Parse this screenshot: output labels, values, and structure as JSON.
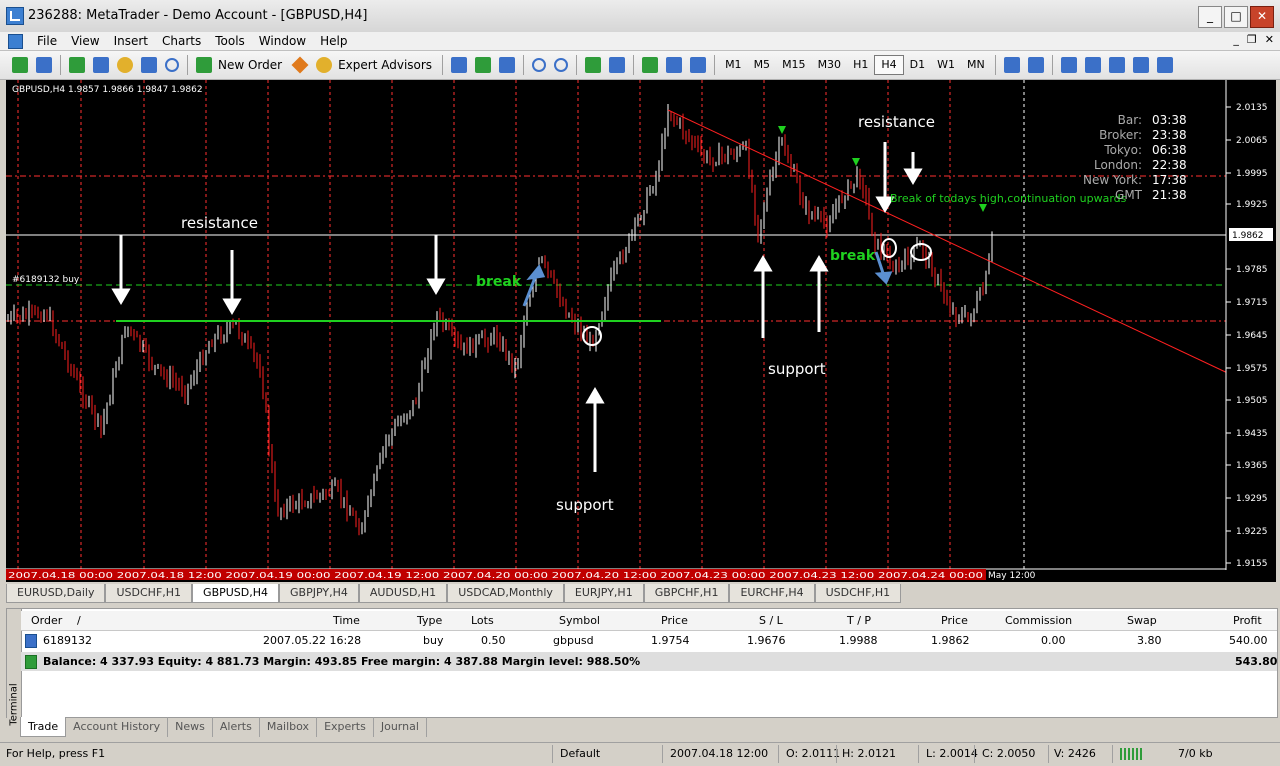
{
  "window": {
    "title": "236288: MetaTrader - Demo Account - [GBPUSD,H4]"
  },
  "menu": {
    "items": [
      "File",
      "View",
      "Insert",
      "Charts",
      "Tools",
      "Window",
      "Help"
    ]
  },
  "toolbar": {
    "new_order": "New Order",
    "expert_advisors": "Expert Advisors",
    "timeframes": [
      "M1",
      "M5",
      "M15",
      "M30",
      "H1",
      "H4",
      "D1",
      "W1",
      "MN"
    ],
    "active_timeframe": "H4"
  },
  "chart": {
    "header": "GBPUSD,H4  1.9857 1.9866 1.9847 1.9862",
    "price_labels": [
      "2.0135",
      "2.0065",
      "1.9995",
      "1.9925",
      "1.9785",
      "1.9715",
      "1.9645",
      "1.9575",
      "1.9505",
      "1.9435",
      "1.9365",
      "1.9295",
      "1.9225",
      "1.9155"
    ],
    "current_price": "1.9862",
    "order_line_label": "#6189132 buy",
    "time_axis_text": "2007.04.18 00:00  2007.04.18 12:00  2007.04.19 00:00  2007.04.19 12:00  2007.04.20 00:00  2007.04.20 12:00  2007.04.23 00:00  2007.04.23 12:00  2007.04.24 00:00",
    "time_axis_end": "May 12:00",
    "annotations": {
      "resistance_left": "resistance",
      "resistance_right": "resistance",
      "break_left": "break",
      "break_right": "break",
      "support_bottom": "support",
      "support_right": "support",
      "break_note": "Break of todays high,continuation upwards"
    },
    "clock": [
      {
        "label": "Bar:",
        "value": "03:38"
      },
      {
        "label": "Broker:",
        "value": "23:38"
      },
      {
        "label": "Tokyo:",
        "value": "06:38"
      },
      {
        "label": "London:",
        "value": "22:38"
      },
      {
        "label": "New York:",
        "value": "17:38"
      },
      {
        "label": "GMT",
        "value": "21:38"
      }
    ],
    "colors": {
      "bull": "#ffffff",
      "bear": "#ff2020",
      "support_line": "#1fd11f",
      "trend_line": "#ff2020",
      "level_red": "#ff3030",
      "level_green": "#1fd11f",
      "text_green": "#1fd11f"
    }
  },
  "symbol_tabs": [
    "EURUSD,Daily",
    "USDCHF,H1",
    "GBPUSD,H4",
    "GBPJPY,H4",
    "AUDUSD,H1",
    "USDCAD,Monthly",
    "EURJPY,H1",
    "GBPCHF,H1",
    "EURCHF,H4",
    "USDCHF,H1"
  ],
  "active_symbol_tab": "GBPUSD,H4",
  "terminal": {
    "side_label": "Terminal",
    "columns": [
      "Order",
      "/",
      "Time",
      "Type",
      "Lots",
      "Symbol",
      "Price",
      "S / L",
      "T / P",
      "Price",
      "Commission",
      "Swap",
      "Profit"
    ],
    "row": {
      "order": "6189132",
      "time": "2007.05.22 16:28",
      "type": "buy",
      "lots": "0.50",
      "symbol": "gbpusd",
      "price": "1.9754",
      "sl": "1.9676",
      "tp": "1.9988",
      "cur_price": "1.9862",
      "commission": "0.00",
      "swap": "3.80",
      "profit": "540.00"
    },
    "balance_text": "Balance: 4 337.93  Equity: 4 881.73  Margin: 493.85  Free margin: 4 387.88  Margin level: 988.50%",
    "balance_profit": "543.80"
  },
  "bottom_tabs": [
    "Trade",
    "Account History",
    "News",
    "Alerts",
    "Mailbox",
    "Experts",
    "Journal"
  ],
  "active_bottom_tab": "Trade",
  "status": {
    "help": "For Help, press F1",
    "profile": "Default",
    "datetime": "2007.04.18 12:00",
    "open": "O: 2.0111",
    "high": "H: 2.0121",
    "low": "L: 2.0014",
    "close": "C: 2.0050",
    "volume": "V: 2426",
    "traffic": "7/0 kb"
  }
}
